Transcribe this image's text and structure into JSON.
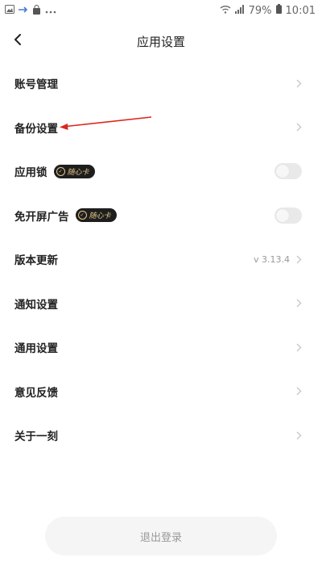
{
  "status_bar": {
    "battery": "79%",
    "time": "10:01"
  },
  "header": {
    "title": "应用设置"
  },
  "settings": {
    "items": [
      {
        "label": "账号管理"
      },
      {
        "label": "备份设置"
      },
      {
        "label": "应用锁",
        "badge": "随心卡",
        "toggle_on": false
      },
      {
        "label": "免开屏广告",
        "badge": "随心卡",
        "toggle_on": false
      },
      {
        "label": "版本更新",
        "value": "v 3.13.4"
      },
      {
        "label": "通知设置"
      },
      {
        "label": "通用设置"
      },
      {
        "label": "意见反馈"
      },
      {
        "label": "关于一刻"
      }
    ]
  },
  "logout": {
    "label": "退出登录"
  },
  "colors": {
    "accent_badge_bg": "#1e1e1e",
    "accent_badge_text": "#e7c88a",
    "annotation_arrow": "#d9281e"
  }
}
